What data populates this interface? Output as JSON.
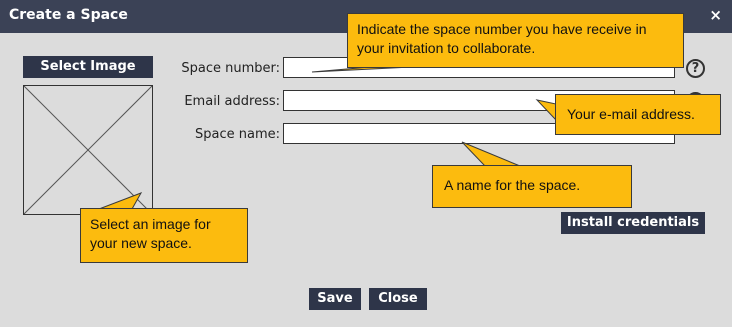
{
  "window": {
    "title": "Create a Space",
    "close_glyph": "×"
  },
  "image": {
    "select_label": "Select Image"
  },
  "form": {
    "space_number_label": "Space number:",
    "email_label": "Email address:",
    "space_name_label": "Space name:",
    "space_number_value": "",
    "email_value": "",
    "space_name_value": "",
    "help_glyph": "?"
  },
  "buttons": {
    "install": "Install credentials",
    "save": "Save",
    "close": "Close"
  },
  "tooltips": {
    "space_number": "Indicate the space number you have receive in your invitation to collaborate.",
    "email": "Your e-mail address.",
    "space_name": "A name for the space.",
    "image": "Select an image for your new space."
  },
  "colors": {
    "titlebar": "#3b4256",
    "button": "#2e3549",
    "tooltip": "#fcbb0e",
    "background": "#dcdcdc"
  }
}
